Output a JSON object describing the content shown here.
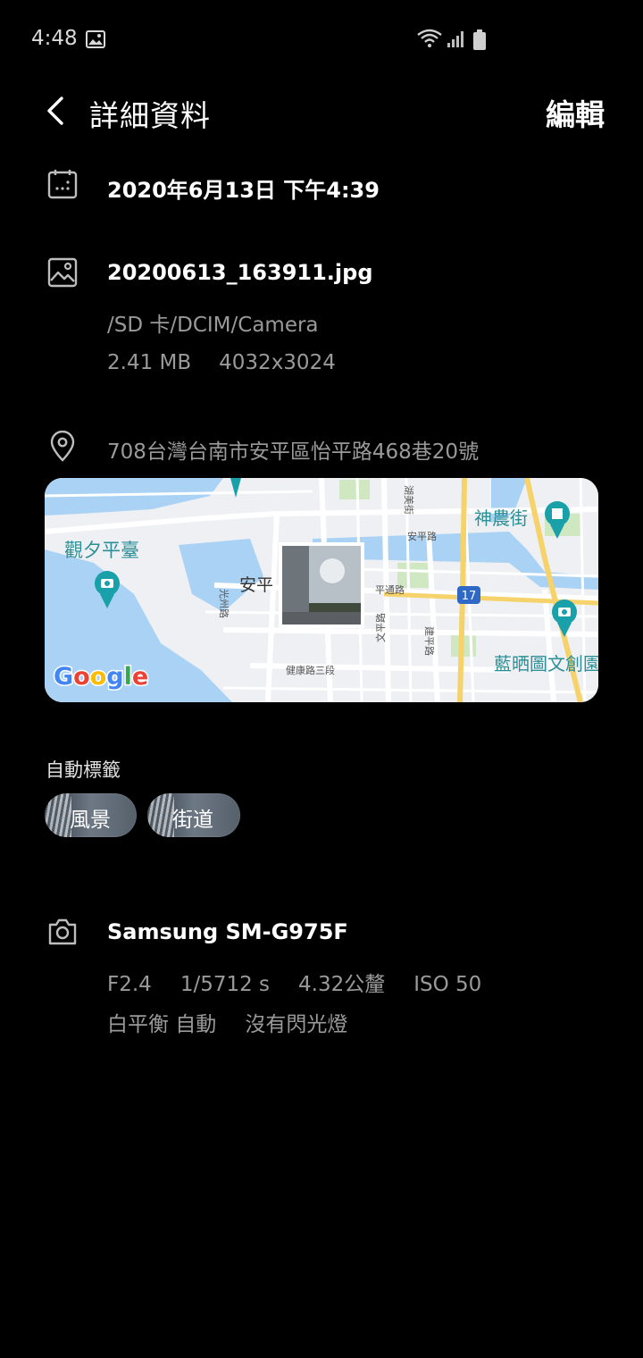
{
  "status_bar": {
    "time": "4:48",
    "icons": [
      "gallery-icon",
      "wifi-icon",
      "signal-icon",
      "battery-icon"
    ]
  },
  "header": {
    "title": "詳細資料",
    "edit_label": "編輯"
  },
  "date_row": {
    "icon": "calendar-icon",
    "datetime": "2020年6月13日 下午4:39"
  },
  "file_row": {
    "icon": "image-icon",
    "filename": "20200613_163911.jpg",
    "path": "/SD 卡/DCIM/Camera",
    "size": "2.41 MB",
    "resolution": "4032x3024"
  },
  "location_row": {
    "icon": "location-pin-icon",
    "address": "708台灣台南市安平區怡平路468巷20號"
  },
  "map": {
    "labels": {
      "guanxi": "觀夕平臺",
      "anping": "安平",
      "shennong": "神農街",
      "lanshai": "藍晒圖文創園",
      "anping_rd": "安平路",
      "pingtong_rd": "平通路",
      "guangzhou_rd": "光州路",
      "jiankang_rd": "健康路三段",
      "wenping_rd": "文平路",
      "jianping_rd": "建平路",
      "hu_mei_st": "湖美街",
      "route": "17",
      "google": "Google"
    },
    "colors": {
      "water": "#a9d2f5",
      "land": "#eef0f3",
      "highway": "#f6d26b",
      "park": "#cfe8c2",
      "poi": "#1aa0a8"
    }
  },
  "auto_tags": {
    "label": "自動標籤",
    "tags": [
      "風景",
      "街道"
    ]
  },
  "camera_row": {
    "icon": "camera-icon",
    "model": "Samsung SM-G975F",
    "aperture": "F2.4",
    "shutter": "1/5712 s",
    "focal_length": "4.32公釐",
    "iso": "ISO 50",
    "white_balance": "白平衡 自動",
    "flash": "沒有閃光燈"
  }
}
